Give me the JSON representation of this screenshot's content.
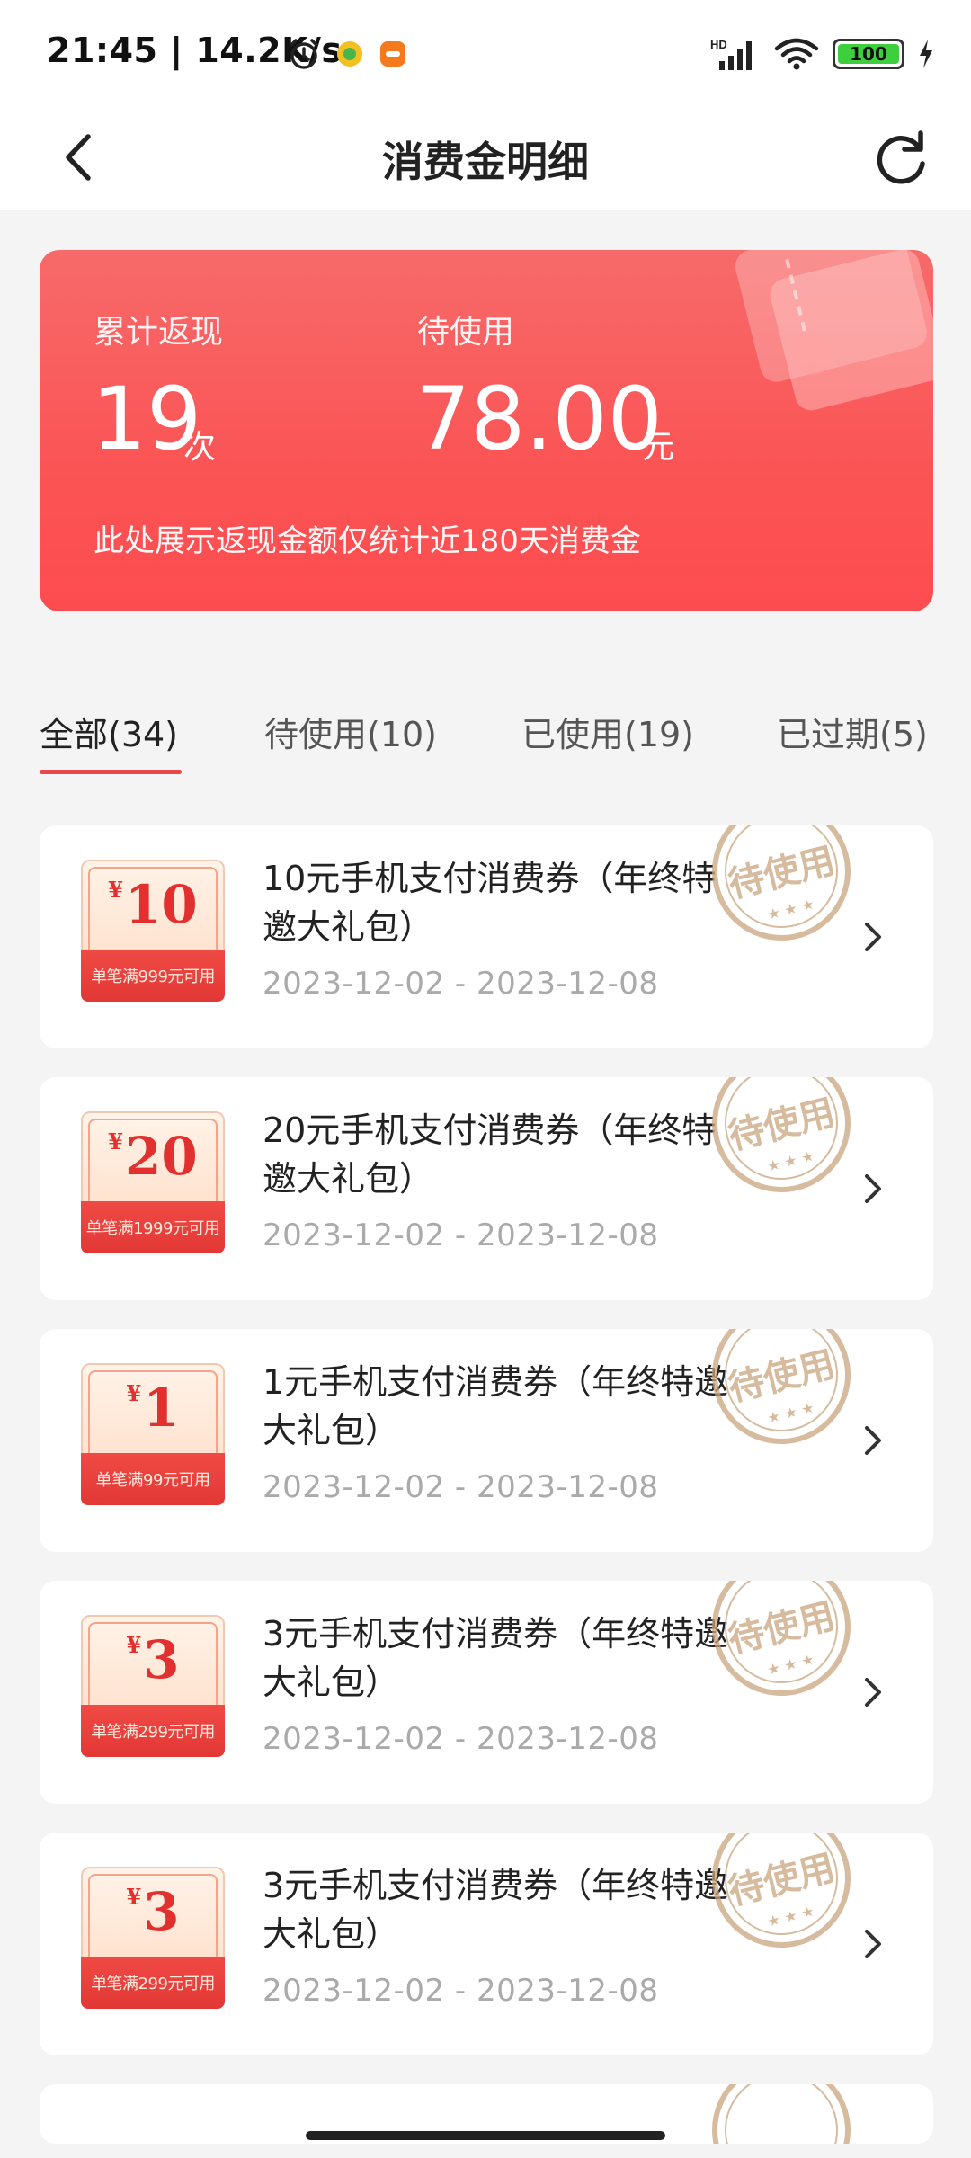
{
  "status_bar": {
    "time": "21:45",
    "speed": "14.2K/s",
    "battery": "100",
    "battery_level": 1.0,
    "icons": [
      "alarm-icon",
      "app-notification-icon",
      "app-notification-icon",
      "signal-icon",
      "wifi-icon",
      "battery-icon",
      "charging-icon"
    ]
  },
  "header": {
    "title": "消费金明细",
    "back_icon": "chevron-left-icon",
    "refresh_icon": "refresh-icon"
  },
  "summary": {
    "cashback_label": "累计返现",
    "cashback_value": "19",
    "cashback_unit": "次",
    "pending_label": "待使用",
    "pending_value": "78.00",
    "pending_unit": "元",
    "note": "此处展示返现金额仅统计近180天消费金",
    "colors": {
      "card_top": "#f76a6a",
      "card_bottom": "#fd4c4f"
    }
  },
  "tabs": [
    {
      "label": "全部(34)",
      "active": true
    },
    {
      "label": "待使用(10)",
      "active": false
    },
    {
      "label": "已使用(19)",
      "active": false
    },
    {
      "label": "已过期(5)",
      "active": false
    }
  ],
  "coupons": [
    {
      "currency": "¥",
      "amount": "10",
      "condition": "单笔满999元可用",
      "title": "10元手机支付消费券（年终特邀大礼包）",
      "date": "2023-12-02 - 2023-12-08",
      "stamp": "待使用"
    },
    {
      "currency": "¥",
      "amount": "20",
      "condition": "单笔满1999元可用",
      "title": "20元手机支付消费券（年终特邀大礼包）",
      "date": "2023-12-02 - 2023-12-08",
      "stamp": "待使用"
    },
    {
      "currency": "¥",
      "amount": "1",
      "condition": "单笔满99元可用",
      "title": "1元手机支付消费券（年终特邀大礼包）",
      "date": "2023-12-02 - 2023-12-08",
      "stamp": "待使用"
    },
    {
      "currency": "¥",
      "amount": "3",
      "condition": "单笔满299元可用",
      "title": "3元手机支付消费券（年终特邀大礼包）",
      "date": "2023-12-02 - 2023-12-08",
      "stamp": "待使用"
    },
    {
      "currency": "¥",
      "amount": "3",
      "condition": "单笔满299元可用",
      "title": "3元手机支付消费券（年终特邀大礼包）",
      "date": "2023-12-02 - 2023-12-08",
      "stamp": "待使用"
    }
  ],
  "colors": {
    "accent": "#e8484a",
    "coupon_red": "#e2302f",
    "stamp": "#c9a57e"
  }
}
